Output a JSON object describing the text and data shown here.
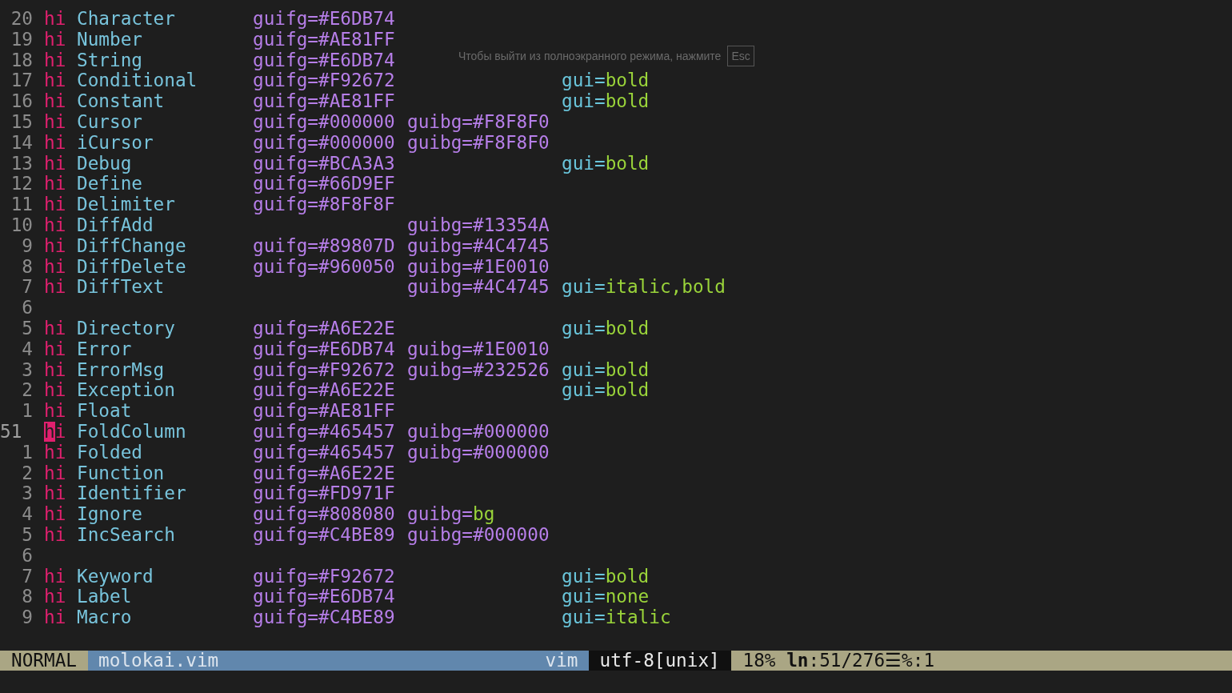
{
  "lines": [
    {
      "num": "20",
      "current": false,
      "kw": "hi",
      "group": "Character",
      "guifg": {
        "attr": "guifg=",
        "value": "#E6DB74",
        "kind": "hex"
      }
    },
    {
      "num": "19",
      "current": false,
      "kw": "hi",
      "group": "Number",
      "guifg": {
        "attr": "guifg=",
        "value": "#AE81FF",
        "kind": "hex"
      }
    },
    {
      "num": "18",
      "current": false,
      "kw": "hi",
      "group": "String",
      "guifg": {
        "attr": "guifg=",
        "value": "#E6DB74",
        "kind": "hex"
      }
    },
    {
      "num": "17",
      "current": false,
      "kw": "hi",
      "group": "Conditional",
      "guifg": {
        "attr": "guifg=",
        "value": "#F92672",
        "kind": "hex"
      },
      "gui": {
        "attr": "gui=",
        "value": "bold",
        "kind": "word"
      }
    },
    {
      "num": "16",
      "current": false,
      "kw": "hi",
      "group": "Constant",
      "guifg": {
        "attr": "guifg=",
        "value": "#AE81FF",
        "kind": "hex"
      },
      "gui": {
        "attr": "gui=",
        "value": "bold",
        "kind": "word"
      }
    },
    {
      "num": "15",
      "current": false,
      "kw": "hi",
      "group": "Cursor",
      "guifg": {
        "attr": "guifg=",
        "value": "#000000",
        "kind": "hex"
      },
      "guibg": {
        "attr": "guibg=",
        "value": "#F8F8F0",
        "kind": "hex"
      }
    },
    {
      "num": "14",
      "current": false,
      "kw": "hi",
      "group": "iCursor",
      "guifg": {
        "attr": "guifg=",
        "value": "#000000",
        "kind": "hex"
      },
      "guibg": {
        "attr": "guibg=",
        "value": "#F8F8F0",
        "kind": "hex"
      }
    },
    {
      "num": "13",
      "current": false,
      "kw": "hi",
      "group": "Debug",
      "guifg": {
        "attr": "guifg=",
        "value": "#BCA3A3",
        "kind": "hex"
      },
      "gui": {
        "attr": "gui=",
        "value": "bold",
        "kind": "word"
      }
    },
    {
      "num": "12",
      "current": false,
      "kw": "hi",
      "group": "Define",
      "guifg": {
        "attr": "guifg=",
        "value": "#66D9EF",
        "kind": "hex"
      }
    },
    {
      "num": "11",
      "current": false,
      "kw": "hi",
      "group": "Delimiter",
      "guifg": {
        "attr": "guifg=",
        "value": "#8F8F8F",
        "kind": "hex"
      }
    },
    {
      "num": "10",
      "current": false,
      "kw": "hi",
      "group": "DiffAdd",
      "guibg": {
        "attr": "guibg=",
        "value": "#13354A",
        "kind": "hex"
      }
    },
    {
      "num": "9",
      "current": false,
      "kw": "hi",
      "group": "DiffChange",
      "guifg": {
        "attr": "guifg=",
        "value": "#89807D",
        "kind": "hex"
      },
      "guibg": {
        "attr": "guibg=",
        "value": "#4C4745",
        "kind": "hex"
      }
    },
    {
      "num": "8",
      "current": false,
      "kw": "hi",
      "group": "DiffDelete",
      "guifg": {
        "attr": "guifg=",
        "value": "#960050",
        "kind": "hex"
      },
      "guibg": {
        "attr": "guibg=",
        "value": "#1E0010",
        "kind": "hex"
      }
    },
    {
      "num": "7",
      "current": false,
      "kw": "hi",
      "group": "DiffText",
      "guibg": {
        "attr": "guibg=",
        "value": "#4C4745",
        "kind": "hex"
      },
      "gui": {
        "attr": "gui=",
        "value": "italic,bold",
        "kind": "word"
      }
    },
    {
      "num": "6",
      "current": false
    },
    {
      "num": "5",
      "current": false,
      "kw": "hi",
      "group": "Directory",
      "guifg": {
        "attr": "guifg=",
        "value": "#A6E22E",
        "kind": "hex"
      },
      "gui": {
        "attr": "gui=",
        "value": "bold",
        "kind": "word"
      }
    },
    {
      "num": "4",
      "current": false,
      "kw": "hi",
      "group": "Error",
      "guifg": {
        "attr": "guifg=",
        "value": "#E6DB74",
        "kind": "hex"
      },
      "guibg": {
        "attr": "guibg=",
        "value": "#1E0010",
        "kind": "hex"
      }
    },
    {
      "num": "3",
      "current": false,
      "kw": "hi",
      "group": "ErrorMsg",
      "guifg": {
        "attr": "guifg=",
        "value": "#F92672",
        "kind": "hex"
      },
      "guibg": {
        "attr": "guibg=",
        "value": "#232526",
        "kind": "hex"
      },
      "gui": {
        "attr": "gui=",
        "value": "bold",
        "kind": "word"
      }
    },
    {
      "num": "2",
      "current": false,
      "kw": "hi",
      "group": "Exception",
      "guifg": {
        "attr": "guifg=",
        "value": "#A6E22E",
        "kind": "hex"
      },
      "gui": {
        "attr": "gui=",
        "value": "bold",
        "kind": "word"
      }
    },
    {
      "num": "1",
      "current": false,
      "kw": "hi",
      "group": "Float",
      "guifg": {
        "attr": "guifg=",
        "value": "#AE81FF",
        "kind": "hex"
      }
    },
    {
      "num": "51",
      "current": true,
      "kw": "hi",
      "group": "FoldColumn",
      "guifg": {
        "attr": "guifg=",
        "value": "#465457",
        "kind": "hex"
      },
      "guibg": {
        "attr": "guibg=",
        "value": "#000000",
        "kind": "hex"
      }
    },
    {
      "num": "1",
      "current": false,
      "kw": "hi",
      "group": "Folded",
      "guifg": {
        "attr": "guifg=",
        "value": "#465457",
        "kind": "hex"
      },
      "guibg": {
        "attr": "guibg=",
        "value": "#000000",
        "kind": "hex"
      }
    },
    {
      "num": "2",
      "current": false,
      "kw": "hi",
      "group": "Function",
      "guifg": {
        "attr": "guifg=",
        "value": "#A6E22E",
        "kind": "hex"
      }
    },
    {
      "num": "3",
      "current": false,
      "kw": "hi",
      "group": "Identifier",
      "guifg": {
        "attr": "guifg=",
        "value": "#FD971F",
        "kind": "hex"
      }
    },
    {
      "num": "4",
      "current": false,
      "kw": "hi",
      "group": "Ignore",
      "guifg": {
        "attr": "guifg=",
        "value": "#808080",
        "kind": "hex"
      },
      "guibg": {
        "attr": "guibg=",
        "value": "bg",
        "kind": "word"
      }
    },
    {
      "num": "5",
      "current": false,
      "kw": "hi",
      "group": "IncSearch",
      "guifg": {
        "attr": "guifg=",
        "value": "#C4BE89",
        "kind": "hex"
      },
      "guibg": {
        "attr": "guibg=",
        "value": "#000000",
        "kind": "hex"
      }
    },
    {
      "num": "6",
      "current": false
    },
    {
      "num": "7",
      "current": false,
      "kw": "hi",
      "group": "Keyword",
      "guifg": {
        "attr": "guifg=",
        "value": "#F92672",
        "kind": "hex"
      },
      "gui": {
        "attr": "gui=",
        "value": "bold",
        "kind": "word"
      }
    },
    {
      "num": "8",
      "current": false,
      "kw": "hi",
      "group": "Label",
      "guifg": {
        "attr": "guifg=",
        "value": "#E6DB74",
        "kind": "hex"
      },
      "gui": {
        "attr": "gui=",
        "value": "none",
        "kind": "word"
      }
    },
    {
      "num": "9",
      "current": false,
      "kw": "hi",
      "group": "Macro",
      "guifg": {
        "attr": "guifg=",
        "value": "#C4BE89",
        "kind": "hex"
      },
      "gui": {
        "attr": "gui=",
        "value": "italic",
        "kind": "word"
      }
    }
  ],
  "status_bar": {
    "mode": "NORMAL",
    "file": "molokai.vim",
    "filetype": "vim",
    "encoding": "utf-8[unix]",
    "percent": "18%",
    "line_icon": "ln",
    "position": ":51/276",
    "column_icon": "☰",
    "column": "%:1"
  },
  "notice": {
    "text": "Чтобы выйти из полноэкранного режима, нажмите",
    "key": "Esc"
  }
}
